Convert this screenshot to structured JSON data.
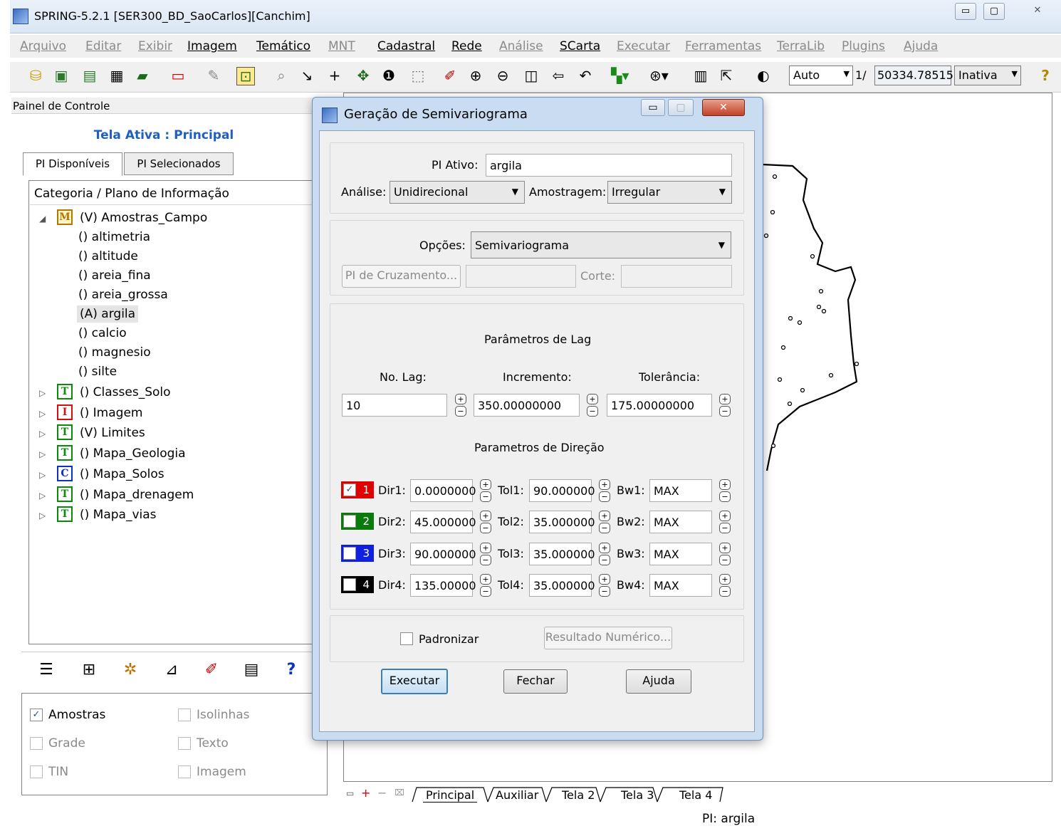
{
  "window": {
    "title": "SPRING-5.2.1 [SER300_BD_SaoCarlos][Canchim]",
    "controls": {
      "minimize": "▭",
      "maximize": "▢",
      "close": "✕"
    }
  },
  "menu": [
    {
      "label": "Arquivo",
      "enabled": false
    },
    {
      "label": "Editar",
      "enabled": false
    },
    {
      "label": "Exibir",
      "enabled": false
    },
    {
      "label": "Imagem",
      "enabled": true
    },
    {
      "label": "Temático",
      "enabled": true
    },
    {
      "label": "MNT",
      "enabled": false
    },
    {
      "label": "Cadastral",
      "enabled": true
    },
    {
      "label": "Rede",
      "enabled": true
    },
    {
      "label": "Análise",
      "enabled": false
    },
    {
      "label": "SCarta",
      "enabled": true
    },
    {
      "label": "Executar",
      "enabled": false
    },
    {
      "label": "Ferramentas",
      "enabled": false
    },
    {
      "label": "TerraLib",
      "enabled": false
    },
    {
      "label": "Plugins",
      "enabled": false
    },
    {
      "label": "Ajuda",
      "enabled": false
    }
  ],
  "toolbar": {
    "zoom_mode": "Auto",
    "scale_prefix": "1/",
    "scale_value": "50334.78515",
    "state": "Inativa",
    "help_icon": "question-icon"
  },
  "panel": {
    "header": "Painel de Controle",
    "active_screen": "Tela Ativa : Principal",
    "tabs": [
      "PI Disponíveis",
      "PI Selecionados"
    ],
    "tree_header": "Categoria / Plano de Informação",
    "tree": {
      "category": {
        "icon": "M",
        "label": "(V) Amostras_Campo"
      },
      "children": [
        "() altimetria",
        "() altitude",
        "() areia_fina",
        "() areia_grossa",
        "(A) argila",
        "() calcio",
        "() magnesio",
        "() silte"
      ],
      "others": [
        {
          "icon": "T",
          "label": "() Classes_Solo",
          "color": "#0a8a0a"
        },
        {
          "icon": "I",
          "label": "() Imagem",
          "color": "#d01010"
        },
        {
          "icon": "T",
          "label": "(V) Limites",
          "color": "#0a8a0a"
        },
        {
          "icon": "T",
          "label": "() Mapa_Geologia",
          "color": "#0a8a0a"
        },
        {
          "icon": "C",
          "label": "() Mapa_Solos",
          "color": "#1030c0"
        },
        {
          "icon": "T",
          "label": "() Mapa_drenagem",
          "color": "#0a8a0a"
        },
        {
          "icon": "T",
          "label": "() Mapa_vias",
          "color": "#0a8a0a"
        }
      ]
    },
    "options": {
      "amostras": "Amostras",
      "isolinhas": "Isolinhas",
      "grade": "Grade",
      "texto": "Texto",
      "tin": "TIN",
      "imagem": "Imagem"
    }
  },
  "screen_tabs": [
    "Principal",
    "Auxiliar",
    "Tela 2",
    "Tela 3",
    "Tela 4"
  ],
  "status": "PI: argila",
  "dialog": {
    "title": "Geração de Semivariograma",
    "pi_ativo_label": "PI Ativo:",
    "pi_ativo_value": "argila",
    "analise_label": "Análise:",
    "analise_value": "Unidirecional",
    "amostragem_label": "Amostragem:",
    "amostragem_value": "Irregular",
    "opcoes_label": "Opções:",
    "opcoes_value": "Semivariograma",
    "pi_cruzamento": "PI de Cruzamento...",
    "corte_label": "Corte:",
    "lag_title": "Parâmetros de Lag",
    "no_lag_label": "No. Lag:",
    "incremento_label": "Incremento:",
    "tolerancia_label": "Tolerância:",
    "no_lag": "10",
    "incremento": "350.00000000",
    "tolerancia": "175.00000000",
    "dir_title": "Parametros de Direção",
    "directions": [
      {
        "num": "1",
        "color": "#e00000",
        "checked": true,
        "dir_label": "Dir1:",
        "dir": "0.0000000",
        "tol_label": "Tol1:",
        "tol": "90.000000",
        "bw_label": "Bw1:",
        "bw": "MAX"
      },
      {
        "num": "2",
        "color": "#0a7a0a",
        "checked": false,
        "dir_label": "Dir2:",
        "dir": "45.000000",
        "tol_label": "Tol2:",
        "tol": "35.000000",
        "bw_label": "Bw2:",
        "bw": "MAX"
      },
      {
        "num": "3",
        "color": "#1020e0",
        "checked": false,
        "dir_label": "Dir3:",
        "dir": "90.000000",
        "tol_label": "Tol3:",
        "tol": "35.000000",
        "bw_label": "Bw3:",
        "bw": "MAX"
      },
      {
        "num": "4",
        "color": "#000000",
        "checked": false,
        "dir_label": "Dir4:",
        "dir": "135.00000",
        "tol_label": "Tol4:",
        "tol": "35.000000",
        "bw_label": "Bw4:",
        "bw": "MAX"
      }
    ],
    "padronizar": "Padronizar",
    "resultado": "Resultado Numérico...",
    "executar": "Executar",
    "fechar": "Fechar",
    "ajuda": "Ajuda"
  }
}
